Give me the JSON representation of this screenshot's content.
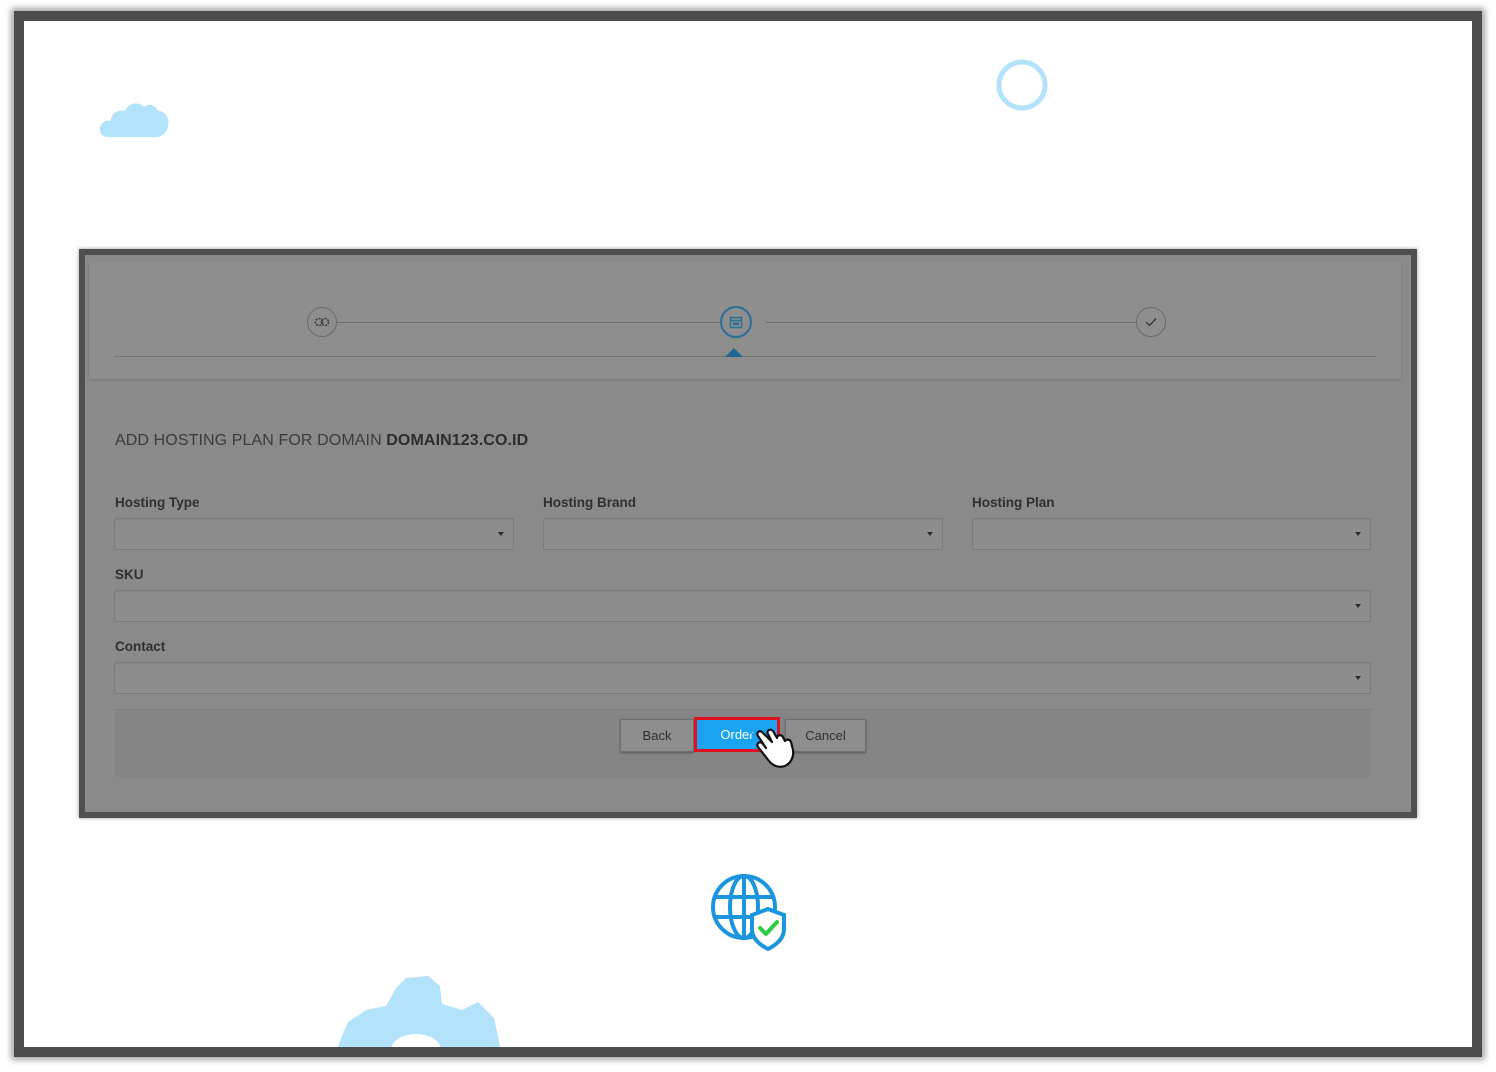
{
  "wizard": {
    "steps": [
      {
        "icon": "gear-cluster-icon",
        "state": "done"
      },
      {
        "icon": "calendar-icon",
        "state": "active"
      },
      {
        "icon": "checkmark-icon",
        "state": "pending"
      }
    ]
  },
  "form": {
    "title_prefix": "ADD HOSTING PLAN FOR DOMAIN",
    "domain": "DOMAIN123.CO.ID",
    "fields": {
      "hosting_type": {
        "label": "Hosting Type",
        "value": ""
      },
      "hosting_brand": {
        "label": "Hosting Brand",
        "value": ""
      },
      "hosting_plan": {
        "label": "Hosting Plan",
        "value": ""
      },
      "sku": {
        "label": "SKU",
        "value": ""
      },
      "contact": {
        "label": "Contact",
        "value": ""
      }
    }
  },
  "buttons": {
    "back": "Back",
    "order": "Order",
    "cancel": "Cancel"
  },
  "colors": {
    "order_button": "#1aa3f0",
    "highlight_border": "#e01020",
    "active_step": "#2a6f98",
    "decoration_blue": "#b3e2fb"
  }
}
